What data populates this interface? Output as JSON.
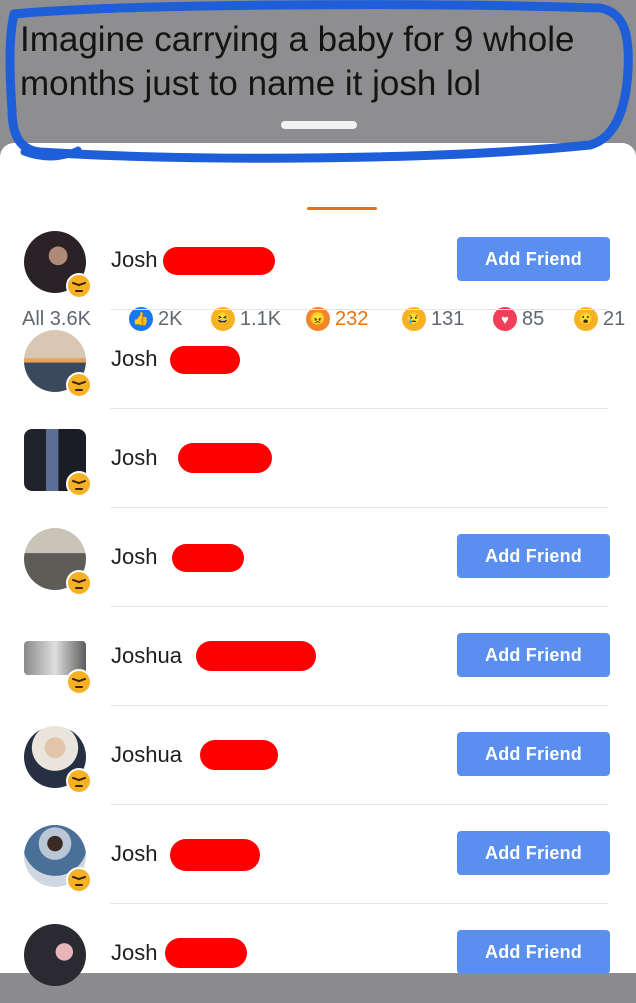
{
  "caption": {
    "line1": "Imagine carrying a baby for 9 whole",
    "line2": "months just to name it josh lol"
  },
  "tabs": [
    {
      "label": "All 3.6K",
      "icon": "none"
    },
    {
      "label": "2K",
      "icon": "like-icon"
    },
    {
      "label": "1.1K",
      "icon": "haha-icon"
    },
    {
      "label": "232",
      "icon": "angry-icon",
      "active": true
    },
    {
      "label": "131",
      "icon": "sad-icon"
    },
    {
      "label": "85",
      "icon": "love-icon"
    },
    {
      "label": "21",
      "icon": "wow-icon"
    }
  ],
  "colors": {
    "active_tab": "#e9710f",
    "add_friend_button": "#5a8ff0",
    "redaction": "#ff0000",
    "annotation_circle": "#1e5fd9"
  },
  "people": [
    {
      "name": "Josh",
      "add_friend": "Add Friend"
    },
    {
      "name": "Josh",
      "add_friend": ""
    },
    {
      "name": "Josh",
      "add_friend": ""
    },
    {
      "name": "Josh",
      "add_friend": "Add Friend"
    },
    {
      "name": "Joshua",
      "add_friend": "Add Friend"
    },
    {
      "name": "Joshua",
      "add_friend": "Add Friend"
    },
    {
      "name": "Josh",
      "add_friend": "Add Friend"
    },
    {
      "name": "Josh",
      "add_friend": "Add Friend"
    }
  ]
}
